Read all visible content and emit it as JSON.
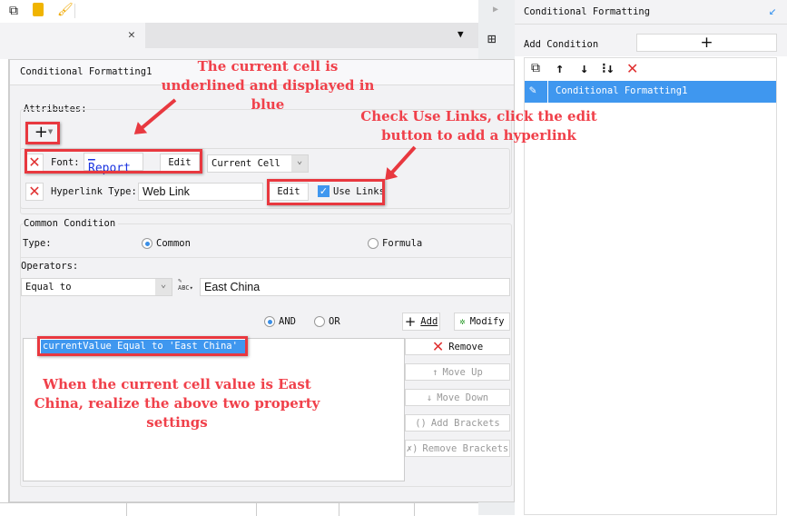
{
  "toolbar": {
    "icons": [
      "copy-icon",
      "paste-icon",
      "format-painter-icon"
    ]
  },
  "dialog": {
    "title": "Conditional Formatting1",
    "attributes_label": "Attributes:",
    "font_label": "Font:",
    "font_preview": "_ Report",
    "font_edit": "Edit",
    "scope_select": "Current Cell",
    "hyperlink_label": "Hyperlink Type:",
    "hyperlink_type": "Web Link",
    "hyperlink_edit": "Edit",
    "use_links": "Use Links",
    "use_links_checked": true,
    "common_condition": "Common Condition",
    "type_label": "Type:",
    "type_common": "Common",
    "type_formula": "Formula",
    "operators_label": "Operators:",
    "operator": "Equal to",
    "value": "East China",
    "and_label": "AND",
    "or_label": "OR",
    "add": "Add",
    "modify": "Modify",
    "condition_item": "currentValue Equal to 'East China'",
    "remove": "Remove",
    "move_up": "Move Up",
    "move_down": "Move Down",
    "add_brackets": "Add Brackets",
    "remove_brackets": "Remove Brackets"
  },
  "right_panel": {
    "title": "Conditional Formatting",
    "add_condition": "Add Condition",
    "items": [
      "Conditional Formatting1"
    ]
  },
  "annotations": {
    "a1": "The current cell is underlined and displayed in blue",
    "a2": "Check Use Links, click the edit button to add a hyperlink",
    "a3": "When the current cell value is East China, realize the above two property settings"
  },
  "colors": {
    "accent": "#3f97ef",
    "annotation": "#f0404a"
  }
}
